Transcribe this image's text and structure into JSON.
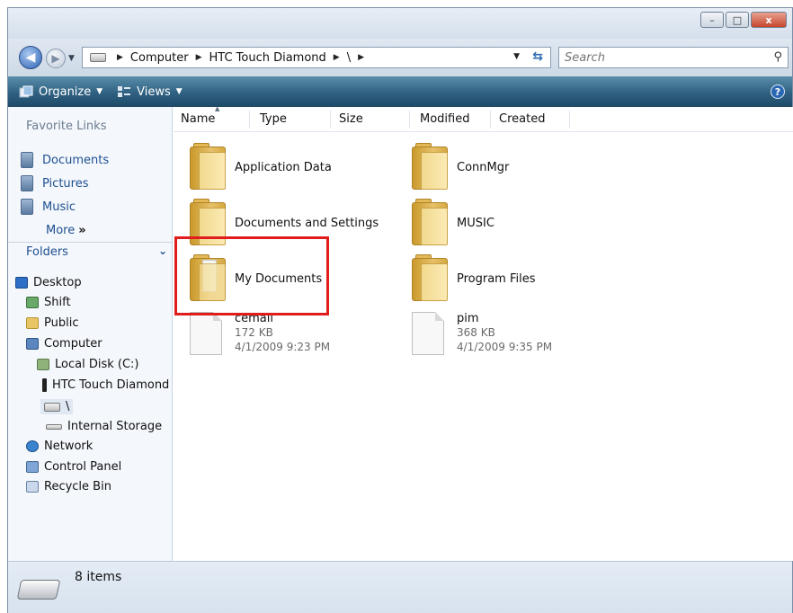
{
  "window": {
    "caption_min": "–",
    "caption_max": "□",
    "caption_close": "x"
  },
  "address_bar": {
    "back_glyph": "◀",
    "forward_glyph": "▶",
    "crumbs": [
      "Computer",
      "HTC Touch Diamond",
      "\\"
    ],
    "search_placeholder": "Search"
  },
  "toolbar": {
    "organize_label": "Organize",
    "views_label": "Views",
    "help_label": "?"
  },
  "nav_pane": {
    "favorites_title": "Favorite Links",
    "favorites": [
      {
        "label": "Documents",
        "icon": "documents-icon"
      },
      {
        "label": "Pictures",
        "icon": "pictures-icon"
      },
      {
        "label": "Music",
        "icon": "music-icon"
      }
    ],
    "more_label": "More",
    "more_glyph": "»",
    "folders_title": "Folders",
    "tree": [
      {
        "label": "Desktop",
        "icon": "desktop-icon"
      },
      {
        "label": "Shift",
        "icon": "user-folder-icon"
      },
      {
        "label": "Public",
        "icon": "folder-icon"
      },
      {
        "label": "Computer",
        "icon": "computer-icon"
      },
      {
        "label": "Local Disk (C:)",
        "icon": "local-disk-icon"
      },
      {
        "label": "HTC Touch Diamond",
        "icon": "phone-icon"
      },
      {
        "label": "\\",
        "icon": "drive-icon"
      },
      {
        "label": "Internal Storage",
        "icon": "storage-icon"
      },
      {
        "label": "Network",
        "icon": "network-icon"
      },
      {
        "label": "Control Panel",
        "icon": "control-panel-icon"
      },
      {
        "label": "Recycle Bin",
        "icon": "recycle-bin-icon"
      }
    ]
  },
  "columns": [
    "Name",
    "Type",
    "Size",
    "Modified",
    "Created"
  ],
  "items": [
    {
      "name": "Application Data",
      "kind": "folder"
    },
    {
      "name": "ConnMgr",
      "kind": "folder"
    },
    {
      "name": "Documents and Settings",
      "kind": "folder"
    },
    {
      "name": "MUSIC",
      "kind": "folder"
    },
    {
      "name": "My Documents",
      "kind": "folder"
    },
    {
      "name": "Program Files",
      "kind": "folder"
    },
    {
      "name": "cemail",
      "kind": "file",
      "size": "172 KB",
      "date": "4/1/2009 9:23 PM"
    },
    {
      "name": "pim",
      "kind": "file",
      "size": "368 KB",
      "date": "4/1/2009 9:35 PM"
    }
  ],
  "status_bar": {
    "item_count": "8 items"
  },
  "colors": {
    "highlight": "#e11c1c",
    "link": "#1d4f91",
    "toolbar": "#2f6081"
  }
}
